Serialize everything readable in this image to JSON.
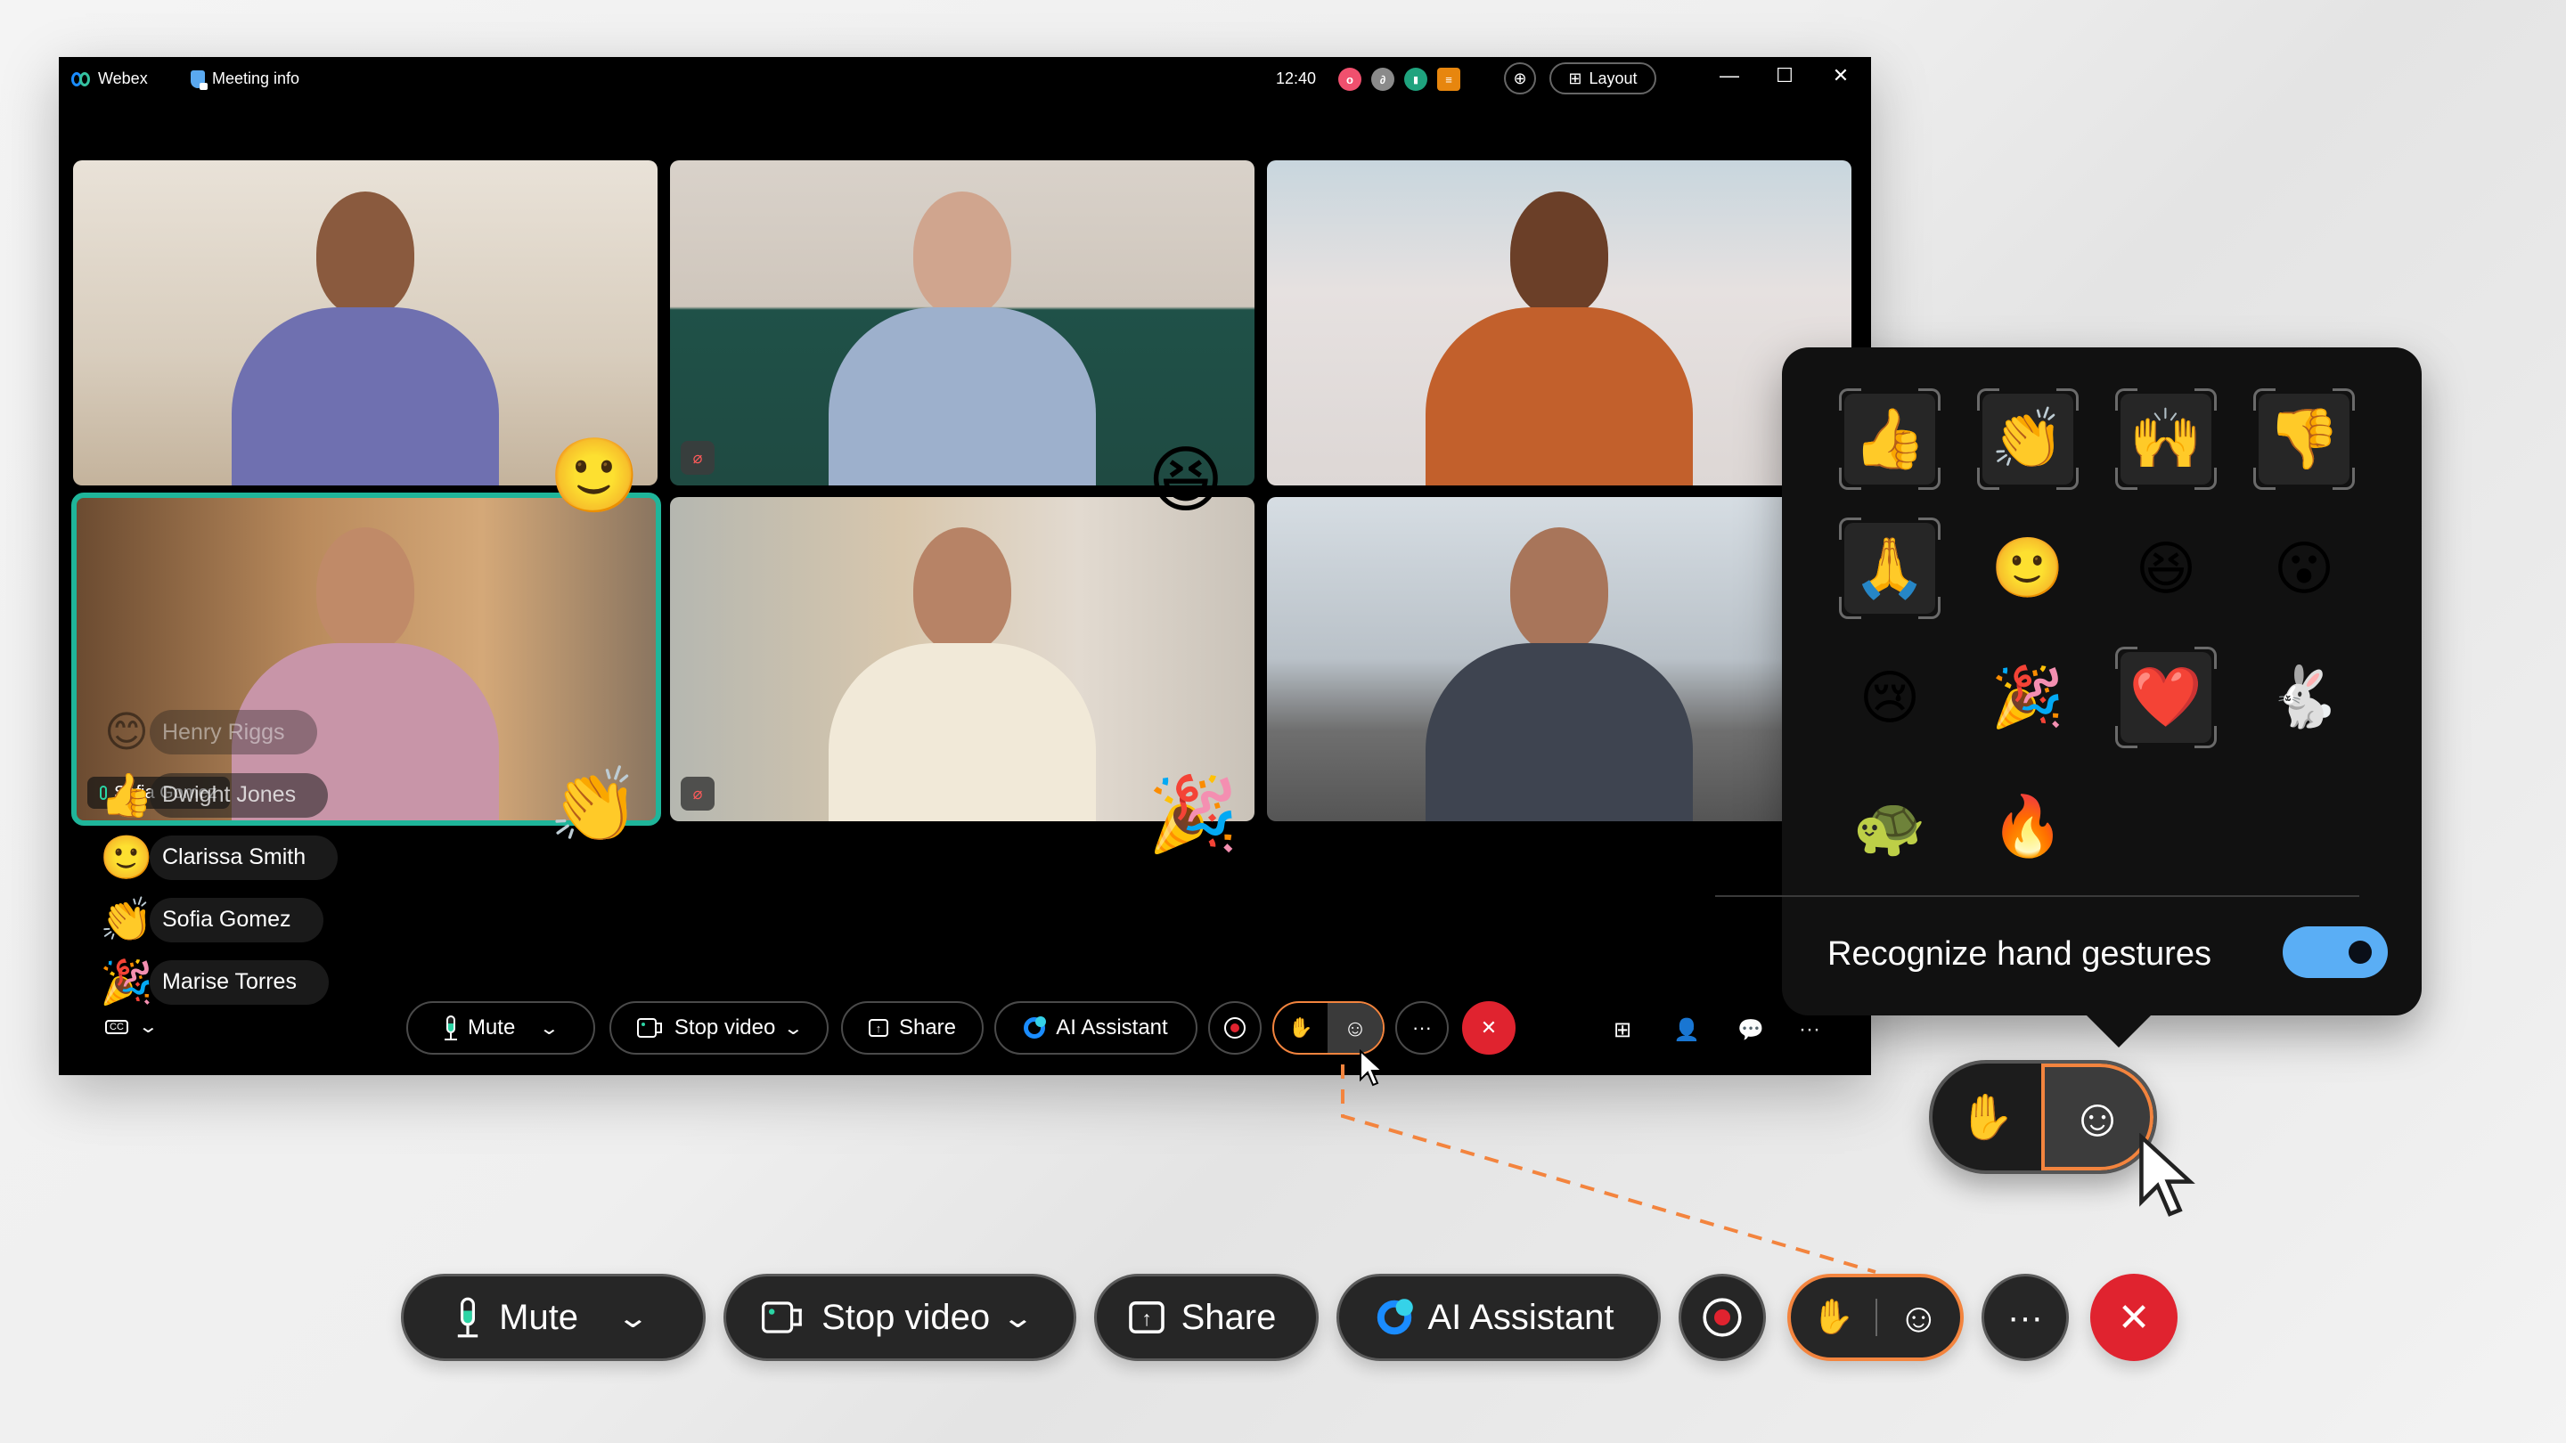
{
  "window": {
    "app_name": "Webex",
    "meeting_info_label": "Meeting info",
    "time": "12:40",
    "status_icons": [
      {
        "name": "recording-indicator",
        "color": "#f0506e"
      },
      {
        "name": "connection-indicator",
        "color": "#8a8a8a"
      },
      {
        "name": "network-stats-indicator",
        "color": "#1fa37e"
      },
      {
        "name": "captions-indicator",
        "color": "#e7860e"
      }
    ],
    "zoom_icon": "zoom-in-icon",
    "layout_label": "Layout",
    "controls": {
      "minimize": "—",
      "maximize": "☐",
      "close": "✕"
    }
  },
  "tiles": [
    {
      "id": "tile-1",
      "muted": false,
      "reaction": "🙂"
    },
    {
      "id": "tile-2",
      "muted": true,
      "reaction": "😆"
    },
    {
      "id": "tile-3",
      "muted": false,
      "reaction": ""
    },
    {
      "id": "tile-4",
      "active_speaker": true,
      "name": "Sofia Gomez",
      "reaction": "👏"
    },
    {
      "id": "tile-5",
      "muted": true,
      "reaction": "🎉"
    },
    {
      "id": "tile-6",
      "muted": false,
      "reaction": ""
    }
  ],
  "reaction_feed": [
    {
      "emoji": "😊",
      "name": "Henry Riggs"
    },
    {
      "emoji": "👍",
      "name": "Dwight Jones"
    },
    {
      "emoji": "🙂",
      "name": "Clarissa Smith"
    },
    {
      "emoji": "👏",
      "name": "Sofia Gomez"
    },
    {
      "emoji": "🎉",
      "name": "Marise Torres"
    }
  ],
  "toolbar": {
    "captions_icon": "CC",
    "mute_label": "Mute",
    "stop_video_label": "Stop video",
    "share_label": "Share",
    "ai_assistant_label": "AI Assistant",
    "more_label": "···",
    "end_label": "✕",
    "right_icons": [
      "apps-icon",
      "participants-icon",
      "chat-icon",
      "more-options-icon"
    ]
  },
  "reactions_popover": {
    "emojis": [
      {
        "emoji": "👍",
        "gesture": true,
        "label": "thumbs up"
      },
      {
        "emoji": "👏",
        "gesture": true,
        "label": "clap"
      },
      {
        "emoji": "🙌",
        "gesture": true,
        "label": "celebrate"
      },
      {
        "emoji": "👎",
        "gesture": true,
        "label": "thumbs down"
      },
      {
        "emoji": "🙏",
        "gesture": true,
        "label": "thank you"
      },
      {
        "emoji": "🙂",
        "gesture": false,
        "label": "smile"
      },
      {
        "emoji": "😆",
        "gesture": false,
        "label": "haha"
      },
      {
        "emoji": "😮",
        "gesture": false,
        "label": "wow"
      },
      {
        "emoji": "😢",
        "gesture": false,
        "label": "sad"
      },
      {
        "emoji": "🎉",
        "gesture": false,
        "label": "party"
      },
      {
        "emoji": "❤️",
        "gesture": true,
        "label": "love"
      },
      {
        "emoji": "🐇",
        "gesture": false,
        "label": "speed up"
      },
      {
        "emoji": "🐢",
        "gesture": false,
        "label": "slow down"
      },
      {
        "emoji": "🔥",
        "gesture": false,
        "label": "fire"
      }
    ],
    "gesture_toggle_label": "Recognize hand gestures",
    "gesture_toggle_on": true
  },
  "accent_colors": {
    "highlight_orange": "#f3843e",
    "end_red": "#e0232f",
    "toggle_blue": "#5aaef5",
    "active_speaker_teal": "#1fb59a"
  }
}
